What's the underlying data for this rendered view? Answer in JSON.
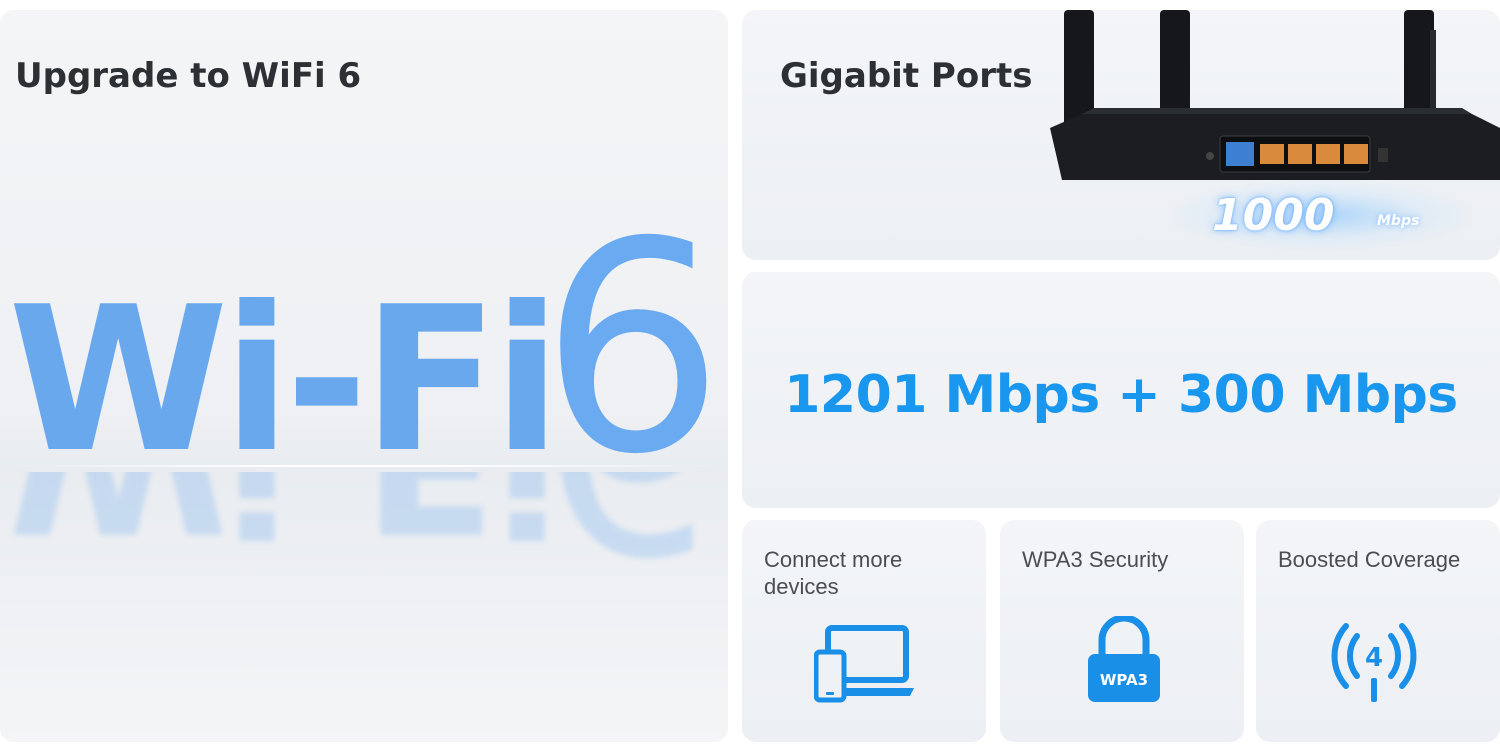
{
  "wifi6_card": {
    "title": "Upgrade to WiFi 6",
    "logo_text": "Wi-Fi",
    "logo_number": "6"
  },
  "gigabit_card": {
    "title": "Gigabit Ports",
    "speed_value": "1000",
    "speed_unit": "Mbps"
  },
  "speed_card": {
    "headline": "1201 Mbps + 300 Mbps"
  },
  "features": [
    {
      "label": "Connect more devices",
      "icon": "devices-icon"
    },
    {
      "label": "WPA3 Security",
      "icon": "padlock-icon",
      "badge": "WPA3"
    },
    {
      "label": "Boosted Coverage",
      "icon": "signal-icon",
      "badge": "4"
    }
  ],
  "colors": {
    "accent_blue": "#1996ee",
    "logo_blue": "#6aa8ee",
    "card_bg": "#f1f3f6",
    "title_text": "#2c2f33"
  }
}
